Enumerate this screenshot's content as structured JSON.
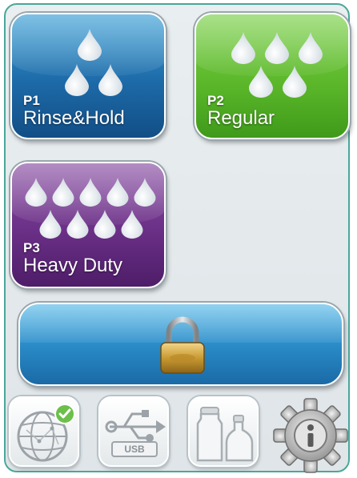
{
  "programs": [
    {
      "code": "P1",
      "name": "Rinse&Hold",
      "drops": 3
    },
    {
      "code": "P2",
      "name": "Regular",
      "drops": 5
    },
    {
      "code": "P3",
      "name": "Heavy Duty",
      "drops": 9
    }
  ],
  "lock": {
    "icon": "padlock-icon"
  },
  "tools": [
    {
      "icon": "network-globe-icon",
      "status_icon": "check-badge-icon"
    },
    {
      "icon": "usb-icon",
      "label": "USB"
    },
    {
      "icon": "detergent-bottles-icon"
    },
    {
      "icon": "info-gear-icon"
    }
  ]
}
